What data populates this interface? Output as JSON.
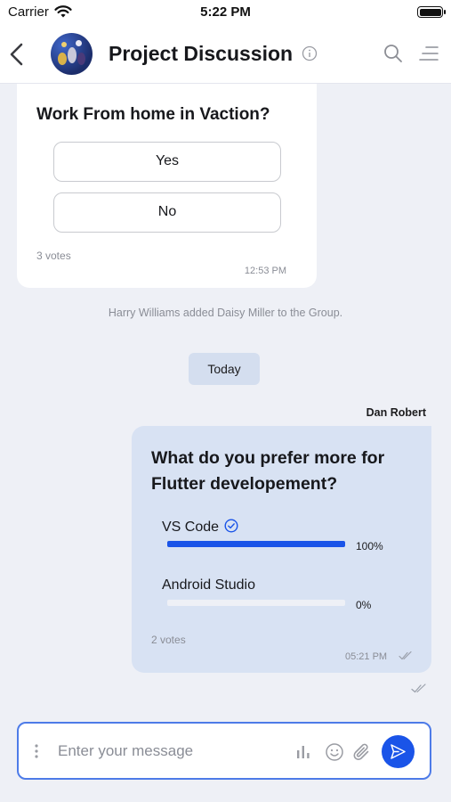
{
  "status_bar": {
    "carrier": "Carrier",
    "time": "5:22 PM"
  },
  "header": {
    "title": "Project Discussion"
  },
  "poll_1": {
    "question": "Work From home in Vaction?",
    "options": [
      {
        "label": "Yes"
      },
      {
        "label": "No"
      }
    ],
    "votes": "3 votes",
    "time": "12:53 PM"
  },
  "system_message": "Harry Williams added Daisy Miller to the Group.",
  "date_separator": "Today",
  "poll_2": {
    "sender": "Dan Robert",
    "question": "What do you prefer more for Flutter developement?",
    "options": [
      {
        "label": "VS Code",
        "percent_label": "100%",
        "fraction": 1.0,
        "selected": true
      },
      {
        "label": "Android Studio",
        "percent_label": "0%",
        "fraction": 0.0,
        "selected": false
      }
    ],
    "votes": "2 votes",
    "time": "05:21 PM"
  },
  "composer": {
    "placeholder": "Enter your message"
  },
  "colors": {
    "accent": "#1a54e8",
    "outgoing_bubble": "#d8e2f3",
    "background": "#eef0f6"
  },
  "icons": [
    "wifi-icon",
    "battery-icon",
    "back-icon",
    "info-icon",
    "search-icon",
    "menu-icon",
    "check-circle-icon",
    "double-check-icon",
    "more-dots-icon",
    "poll-icon",
    "emoji-icon",
    "attach-icon",
    "send-icon"
  ]
}
